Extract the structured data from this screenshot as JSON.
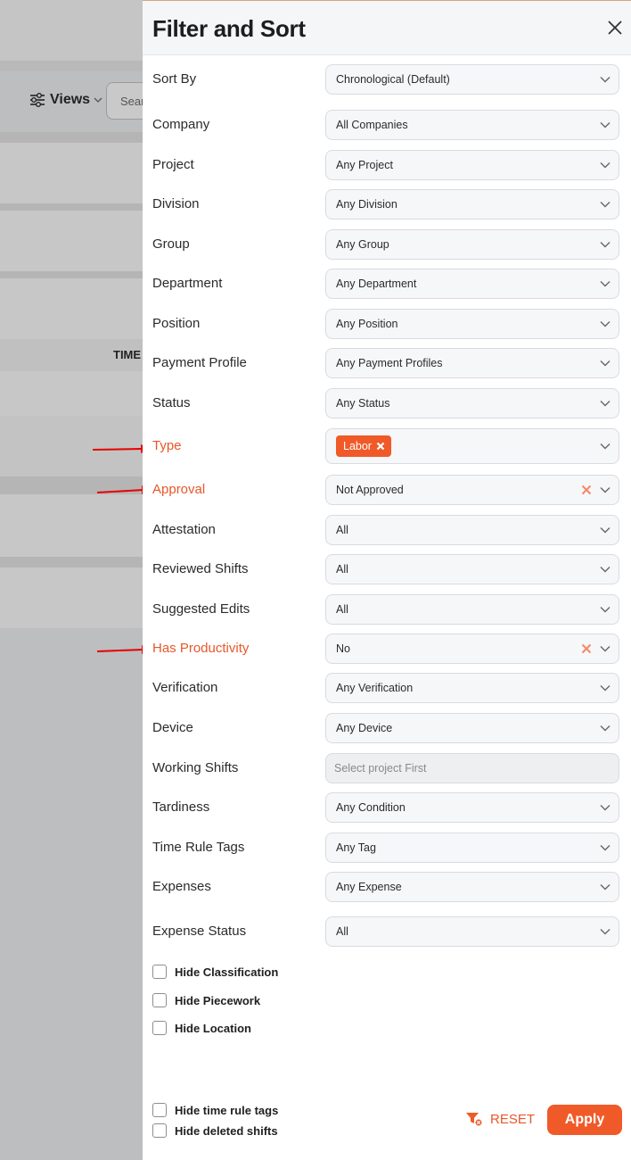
{
  "background": {
    "views_label": "Views",
    "search_placeholder": "Sear",
    "time_header": "TIME"
  },
  "panel": {
    "title": "Filter and Sort",
    "filters": [
      {
        "label": "Sort By",
        "value": "Chronological (Default)"
      },
      {
        "label": "Company",
        "value": "All Companies"
      },
      {
        "label": "Project",
        "value": "Any Project"
      },
      {
        "label": "Division",
        "value": "Any Division"
      },
      {
        "label": "Group",
        "value": "Any Group"
      },
      {
        "label": "Department",
        "value": "Any Department"
      },
      {
        "label": "Position",
        "value": "Any Position"
      },
      {
        "label": "Payment Profile",
        "value": "Any Payment Profiles"
      },
      {
        "label": "Status",
        "value": "Any Status"
      },
      {
        "label": "Type",
        "chip": "Labor",
        "highlighted": true
      },
      {
        "label": "Approval",
        "value": "Not Approved",
        "highlighted": true,
        "clearable": true
      },
      {
        "label": "Attestation",
        "value": "All"
      },
      {
        "label": "Reviewed Shifts",
        "value": "All"
      },
      {
        "label": "Suggested Edits",
        "value": "All"
      },
      {
        "label": "Has Productivity",
        "value": "No",
        "highlighted": true,
        "clearable": true
      },
      {
        "label": "Verification",
        "value": "Any Verification"
      },
      {
        "label": "Device",
        "value": "Any Device"
      },
      {
        "label": "Working Shifts",
        "placeholder": "Select project First",
        "disabled": true
      },
      {
        "label": "Tardiness",
        "value": "Any Condition"
      },
      {
        "label": "Time Rule Tags",
        "value": "Any Tag"
      },
      {
        "label": "Expenses",
        "value": "Any Expense"
      },
      {
        "label": "Expense Status",
        "value": "All"
      }
    ],
    "checkboxes": [
      "Hide Classification",
      "Hide Piecework",
      "Hide Location"
    ],
    "footer_checkboxes": [
      "Hide time rule tags",
      "Hide deleted shifts"
    ],
    "reset_label": "RESET",
    "apply_label": "Apply"
  },
  "colors": {
    "accent": "#f05a28",
    "highlight_text": "#e8572a",
    "annotation_arrow": "#e60000"
  }
}
